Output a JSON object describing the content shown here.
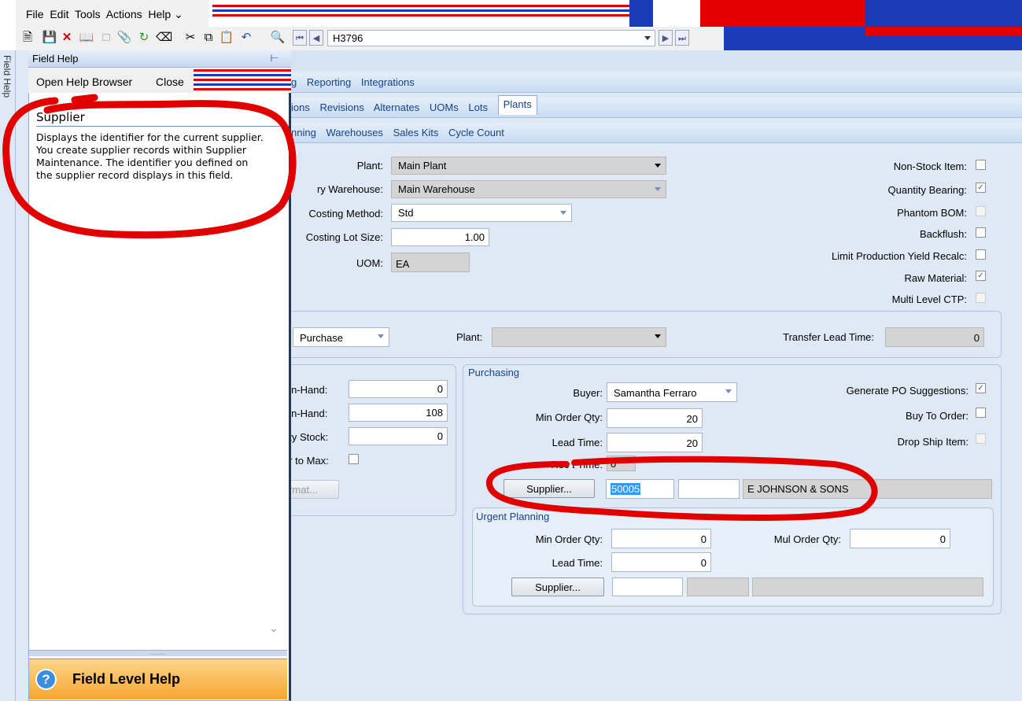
{
  "menu": {
    "items": [
      "File",
      "Edit",
      "Tools",
      "Actions",
      "Help"
    ]
  },
  "toolbar": {
    "record_id": "H3796"
  },
  "field_help_panel": {
    "title": "Field Help",
    "side_tab": "Field Help",
    "open_browser": "Open Help Browser",
    "close": "Close",
    "field_name": "Supplier",
    "description": "Displays the identifier for the current supplier. You create supplier records within Supplier Maintenance. The identifier you defined on the supplier record displays in this field.",
    "footer": "Field Level Help"
  },
  "tabs": {
    "row1": [
      "g",
      "Reporting",
      "Integrations"
    ],
    "row2": [
      "ions",
      "Revisions",
      "Alternates",
      "UOMs",
      "Lots",
      "Plants"
    ],
    "row3": [
      "nning",
      "Warehouses",
      "Sales Kits",
      "Cycle Count"
    ]
  },
  "plant": {
    "plant_label": "Plant:",
    "plant_value": "Main Plant",
    "warehouse_label": "ry Warehouse:",
    "warehouse_value": "Main Warehouse",
    "costing_method_label": "Costing Method:",
    "costing_method_value": "Std",
    "costing_lot_label": "Costing Lot Size:",
    "costing_lot_value": "1.00",
    "uom_label": "UOM:",
    "uom_value": "EA"
  },
  "flags": [
    {
      "label": "Non-Stock Item:",
      "checked": false,
      "disabled": false
    },
    {
      "label": "Quantity Bearing:",
      "checked": true,
      "disabled": false
    },
    {
      "label": "Phantom BOM:",
      "checked": false,
      "disabled": true
    },
    {
      "label": "Backflush:",
      "checked": false,
      "disabled": false
    },
    {
      "label": "Limit Production Yield Recalc:",
      "checked": false,
      "disabled": false
    },
    {
      "label": "Raw Material:",
      "checked": true,
      "disabled": false
    },
    {
      "label": "Multi Level CTP:",
      "checked": false,
      "disabled": true
    }
  ],
  "source": {
    "type_value": "Purchase",
    "plant_label": "Plant:",
    "plant_value": "",
    "transfer_lead_label": "Transfer Lead Time:",
    "transfer_lead_value": "0"
  },
  "inventory": {
    "onhand1_label": "On-Hand:",
    "onhand1_value": "0",
    "onhand2_label": "On-Hand:",
    "onhand2_value": "108",
    "safety_label": "ety Stock:",
    "safety_value": "0",
    "order_max_label": "er to Max:",
    "format_button": "rmat..."
  },
  "purchasing": {
    "title": "Purchasing",
    "buyer_label": "Buyer:",
    "buyer_value": "Samantha Ferraro",
    "min_order_label": "Min Order Qty:",
    "min_order_value": "20",
    "lead_time_label": "Lead Time:",
    "lead_time_value": "20",
    "receive_time_label": "Rec    t Time:",
    "receive_time_value": "0",
    "supplier_button": "Supplier...",
    "supplier_id": "50005",
    "supplier_name": "E JOHNSON & SONS",
    "gen_po_label": "Generate PO Suggestions:",
    "gen_po_checked": true,
    "buy_to_order_label": "Buy To Order:",
    "buy_to_order_checked": false,
    "drop_ship_label": "Drop Ship Item:",
    "drop_ship_checked": false
  },
  "urgent": {
    "title": "Urgent Planning",
    "min_order_label": "Min Order Qty:",
    "min_order_value": "0",
    "lead_time_label": "Lead Time:",
    "lead_time_value": "0",
    "mul_order_label": "Mul Order Qty:",
    "mul_order_value": "0",
    "supplier_button": "Supplier..."
  },
  "colors": {
    "accent": "#15428b",
    "annotation": "#e00000",
    "help_footer": "#f7a530"
  }
}
